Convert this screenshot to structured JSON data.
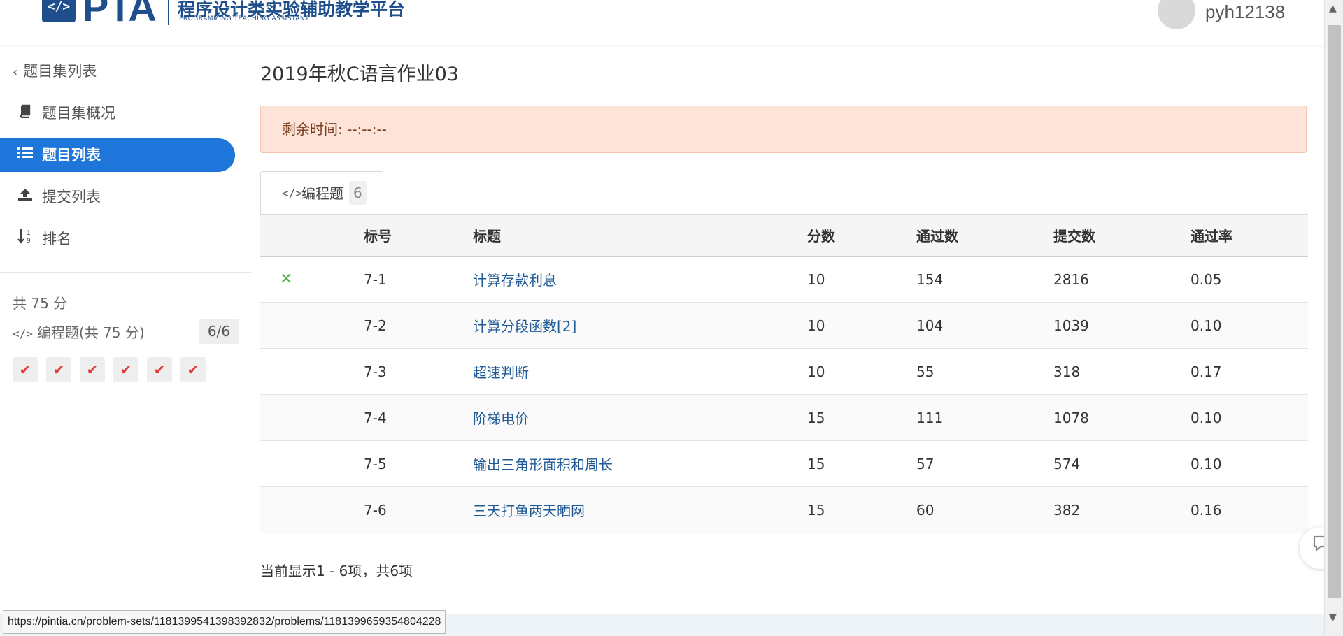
{
  "header": {
    "logo_code": "</>",
    "logo_text": "PTA",
    "logo_cn": "程序设计类实验辅助教学平台",
    "logo_en": "PROGRAMMING TEACHING ASSISTANT",
    "username": "pyh12138"
  },
  "sidebar": {
    "back_label": "题目集列表",
    "items": [
      {
        "label": "题目集概况",
        "icon": "book-icon",
        "active": false
      },
      {
        "label": "题目列表",
        "icon": "list-icon",
        "active": true
      },
      {
        "label": "提交列表",
        "icon": "upload-icon",
        "active": false
      },
      {
        "label": "排名",
        "icon": "sort-number-icon",
        "active": false
      }
    ],
    "total": "共 75 分",
    "category": {
      "label": "编程题(共 75 分)",
      "count": "6/6",
      "icon": "code-icon"
    },
    "checks": 6
  },
  "main": {
    "title": "2019年秋C语言作业03",
    "alert": "剩余时间: --:--:--",
    "tab": {
      "label": "编程题",
      "count": "6",
      "icon": "code-icon"
    },
    "table": {
      "headers": [
        "",
        "标号",
        "标题",
        "分数",
        "通过数",
        "提交数",
        "通过率"
      ],
      "rows": [
        {
          "status": "✕",
          "id": "7-1",
          "title": "计算存款利息",
          "score": "10",
          "passed": "154",
          "submitted": "2816",
          "rate": "0.05"
        },
        {
          "status": "",
          "id": "7-2",
          "title": "计算分段函数[2]",
          "score": "10",
          "passed": "104",
          "submitted": "1039",
          "rate": "0.10"
        },
        {
          "status": "",
          "id": "7-3",
          "title": "超速判断",
          "score": "10",
          "passed": "55",
          "submitted": "318",
          "rate": "0.17"
        },
        {
          "status": "",
          "id": "7-4",
          "title": "阶梯电价",
          "score": "15",
          "passed": "111",
          "submitted": "1078",
          "rate": "0.10"
        },
        {
          "status": "",
          "id": "7-5",
          "title": "输出三角形面积和周长",
          "score": "15",
          "passed": "57",
          "submitted": "574",
          "rate": "0.10"
        },
        {
          "status": "",
          "id": "7-6",
          "title": "三天打鱼两天晒网",
          "score": "15",
          "passed": "60",
          "submitted": "382",
          "rate": "0.16"
        }
      ]
    },
    "pager": "当前显示1 - 6项，共6项"
  },
  "statusbar": {
    "url": "https://pintia.cn/problem-sets/1181399541398392832/problems/1181399659354804228"
  },
  "colors": {
    "accent": "#1f76da",
    "brand": "#1f4e8c",
    "alert_bg": "#fde3d8",
    "link": "#1f5a96",
    "check_red": "#e03b3b",
    "status_green": "#4cae4c"
  }
}
